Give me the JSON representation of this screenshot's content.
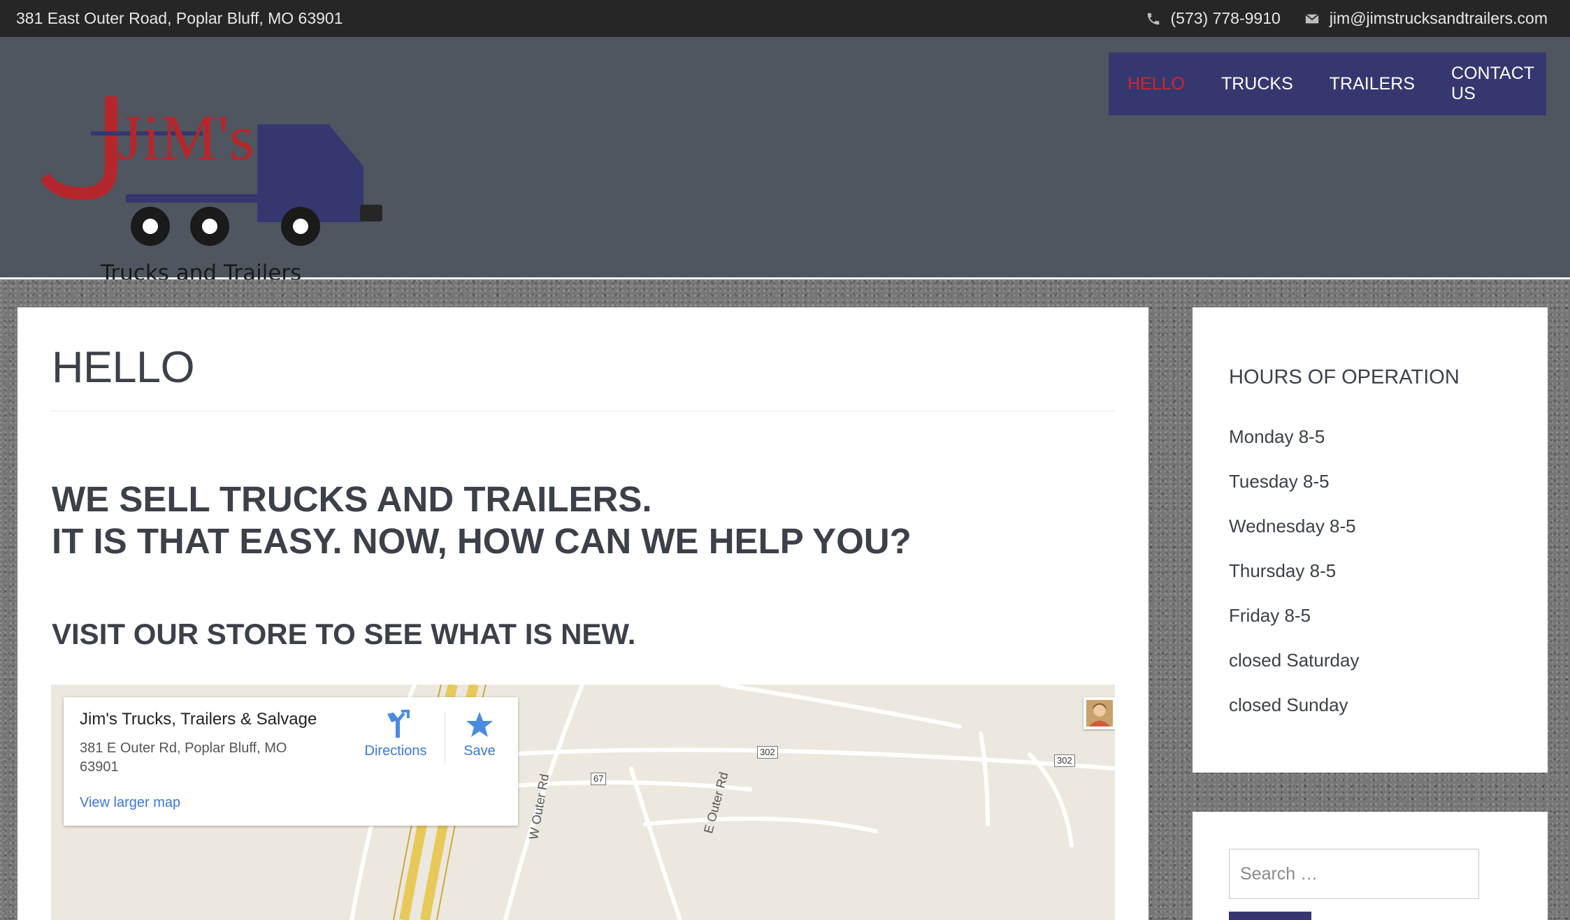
{
  "topbar": {
    "address": "381 East Outer Road, Poplar Bluff, MO 63901",
    "phone": "(573) 778-9910",
    "email": "jim@jimstrucksandtrailers.com",
    "phone_icon": "phone-icon",
    "email_icon": "envelope-icon"
  },
  "logo": {
    "main_text": "JiM's",
    "tagline": "Trucks and Trailers",
    "colors": {
      "red": "#b5262c",
      "blue": "#35386f"
    }
  },
  "nav": {
    "items": [
      {
        "label": "HELLO",
        "active": true
      },
      {
        "label": "TRUCKS",
        "active": false
      },
      {
        "label": "TRAILERS",
        "active": false
      },
      {
        "label": "CONTACT US",
        "active": false
      }
    ],
    "active_color": "#d1262b",
    "background": "#35386f"
  },
  "main": {
    "title": "HELLO",
    "headline_line1": "WE SELL TRUCKS AND TRAILERS.",
    "headline_line2": "IT IS THAT EASY. NOW, HOW CAN WE HELP YOU?",
    "subhead": "VISIT OUR STORE TO SEE WHAT IS NEW."
  },
  "map": {
    "place_name": "Jim's Trucks, Trailers & Salvage",
    "address": "381 E Outer Rd, Poplar Bluff, MO 63901",
    "view_larger": "View larger map",
    "directions": "Directions",
    "save": "Save",
    "road_labels": [
      "W Outer Rd",
      "E Outer Rd"
    ],
    "shields": [
      "67",
      "302",
      "302"
    ]
  },
  "sidebar": {
    "hours_title": "HOURS OF OPERATION",
    "hours": [
      "Monday 8-5",
      "Tuesday 8-5",
      "Wednesday 8-5",
      "Thursday 8-5",
      "Friday 8-5",
      "closed Saturday",
      "closed Sunday"
    ],
    "search_placeholder": "Search …"
  }
}
